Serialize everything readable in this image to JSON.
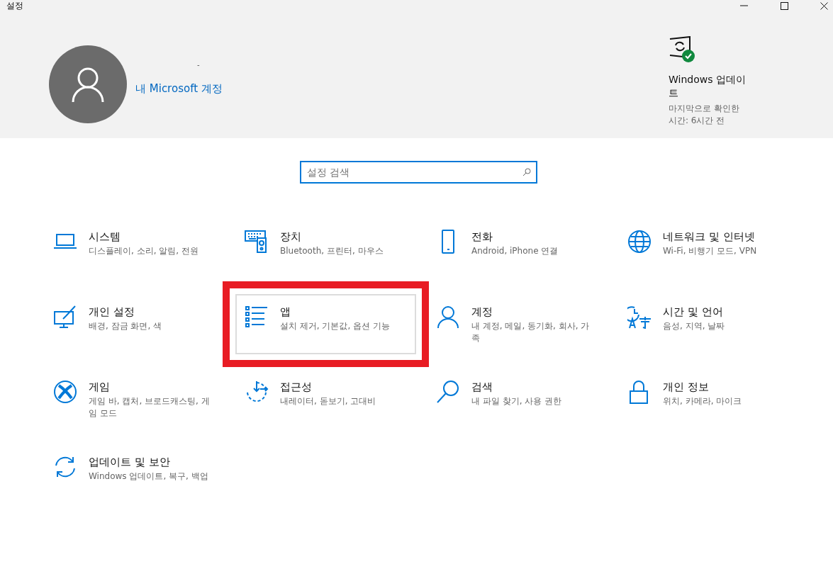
{
  "window": {
    "title": "설정"
  },
  "account": {
    "name": "-",
    "link": "내 Microsoft 계정"
  },
  "update": {
    "title": "Windows 업데이트",
    "status": "마지막으로 확인한 시간: 6시간 전"
  },
  "search": {
    "placeholder": "설정 검색"
  },
  "categories": [
    {
      "title": "시스템",
      "description": "디스플레이, 소리, 알림, 전원",
      "selected": false
    },
    {
      "title": "장치",
      "description": "Bluetooth, 프린터, 마우스",
      "selected": false
    },
    {
      "title": "전화",
      "description": "Android, iPhone 연결",
      "selected": false
    },
    {
      "title": "네트워크 및 인터넷",
      "description": "Wi-Fi, 비행기 모드, VPN",
      "selected": false
    },
    {
      "title": "개인 설정",
      "description": "배경, 잠금 화면, 색",
      "selected": false
    },
    {
      "title": "앱",
      "description": "설치 제거, 기본값, 옵션 기능",
      "selected": true
    },
    {
      "title": "계정",
      "description": "내 계정, 메일, 동기화, 회사, 가족",
      "selected": false
    },
    {
      "title": "시간 및 언어",
      "description": "음성, 지역, 날짜",
      "selected": false
    },
    {
      "title": "게임",
      "description": "게임 바, 캡처, 브로드캐스팅, 게임 모드",
      "selected": false
    },
    {
      "title": "접근성",
      "description": "내레이터, 돋보기, 고대비",
      "selected": false
    },
    {
      "title": "검색",
      "description": "내 파일 찾기, 사용 권한",
      "selected": false
    },
    {
      "title": "개인 정보",
      "description": "위치, 카메라, 마이크",
      "selected": false
    },
    {
      "title": "업데이트 및 보안",
      "description": "Windows 업데이트, 복구, 백업",
      "selected": false
    }
  ]
}
